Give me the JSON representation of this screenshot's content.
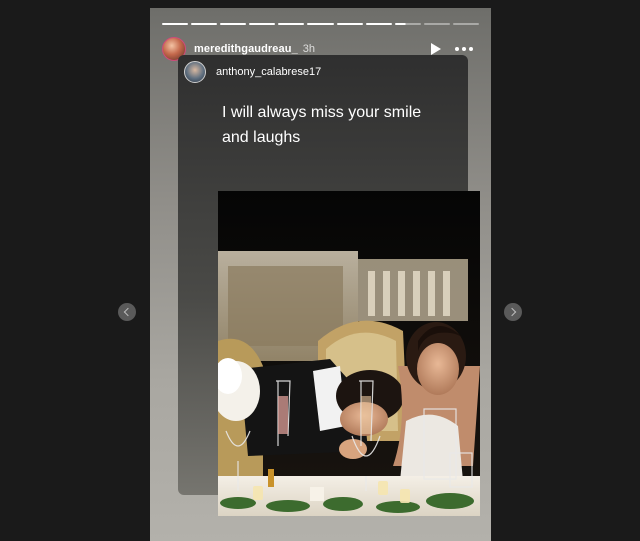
{
  "story": {
    "progress": {
      "total": 11,
      "completed": 8,
      "current_fraction": 0.4
    },
    "author": {
      "username": "meredithgaudreau_",
      "time_ago": "3h"
    },
    "controls": {
      "play_icon": "play-icon",
      "more_icon": "more-icon"
    }
  },
  "repost": {
    "username": "anthony_calabrese17",
    "caption": "I will always miss your smile and laughs",
    "photo": "wedding-head-table-photo"
  },
  "navigation": {
    "prev_icon": "chevron-left-icon",
    "next_icon": "chevron-right-icon"
  }
}
